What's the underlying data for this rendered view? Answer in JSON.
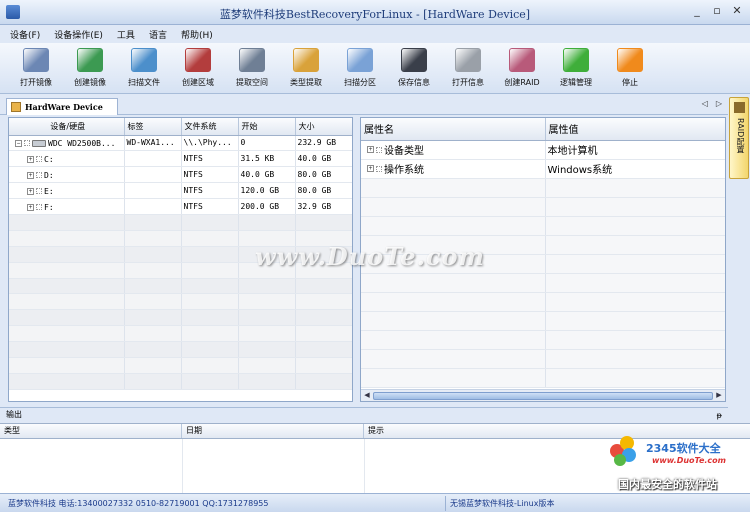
{
  "window": {
    "title": "蓝梦软件科技BestRecoveryForLinux - [HardWare Device]",
    "min": "_",
    "restore": "▫",
    "close": "✕"
  },
  "menu": [
    "设备(F)",
    "设备操作(E)",
    "工具",
    "语言",
    "帮助(H)"
  ],
  "toolbar": [
    {
      "label": "打开镜像",
      "icon": "open-image-icon",
      "color": "#6c87b4"
    },
    {
      "label": "创建镜像",
      "icon": "create-image-icon",
      "color": "#3c9a52"
    },
    {
      "label": "扫描文件",
      "icon": "scan-file-icon",
      "color": "#4c8fcb"
    },
    {
      "label": "创建区域",
      "icon": "create-region-icon",
      "color": "#b33d3d"
    },
    {
      "label": "提取空间",
      "icon": "extract-space-icon",
      "color": "#6f7f95"
    },
    {
      "label": "类型提取",
      "icon": "type-extract-icon",
      "color": "#d9a23a"
    },
    {
      "label": "扫描分区",
      "icon": "scan-partition-icon",
      "color": "#7aa2d6"
    },
    {
      "label": "保存信息",
      "icon": "save-info-icon",
      "color": "#3a3f4a"
    },
    {
      "label": "打开信息",
      "icon": "open-info-icon",
      "color": "#9aa0a8"
    },
    {
      "label": "创建RAID",
      "icon": "create-raid-icon",
      "color": "#b85a7a"
    },
    {
      "label": "逻辑管理",
      "icon": "logic-manage-icon",
      "color": "#3fae3a"
    },
    {
      "label": "停止",
      "icon": "stop-icon",
      "color": "#f08a1c"
    }
  ],
  "doc_tab": {
    "label": "HardWare Device",
    "nav_prev": "◁",
    "nav_next": "▷"
  },
  "side_tab": {
    "label": "RAID配置"
  },
  "device_table": {
    "headers": [
      "设备/硬盘",
      "标签",
      "文件系统",
      "开始",
      "大小"
    ],
    "rows": [
      {
        "name": "WDC WD2500B...",
        "label": "WD-WXA1...",
        "fs": "\\\\.\\Phy...",
        "start": "0",
        "size": "232.9 GB",
        "level": 0
      },
      {
        "name": "C:",
        "label": "",
        "fs": "NTFS",
        "start": "31.5 KB",
        "size": "40.0 GB",
        "level": 1
      },
      {
        "name": "D:",
        "label": "",
        "fs": "NTFS",
        "start": "40.0 GB",
        "size": "80.0 GB",
        "level": 1
      },
      {
        "name": "E:",
        "label": "",
        "fs": "NTFS",
        "start": "120.0 GB",
        "size": "80.0 GB",
        "level": 1
      },
      {
        "name": "F:",
        "label": "",
        "fs": "NTFS",
        "start": "200.0 GB",
        "size": "32.9 GB",
        "level": 1
      }
    ]
  },
  "property_table": {
    "headers": [
      "属性名",
      "属性值"
    ],
    "rows": [
      {
        "name": "设备类型",
        "value": "本地计算机"
      },
      {
        "name": "操作系统",
        "value": "Windows系统"
      }
    ]
  },
  "watermark": "www.DuoTe.com",
  "output": {
    "title": "输出",
    "pin": "ᵽ",
    "headers": [
      "类型",
      "日期",
      "提示"
    ]
  },
  "status": {
    "left": "蓝梦软件科技 电话:13400027332  0510-82719001  QQ:1731278955",
    "right": "无锡蓝梦软件科技-Linux版本"
  },
  "logo": {
    "brand": "2345软件大全",
    "url": "www.DuoTe.com",
    "slogan": "国内最安全的软件站"
  }
}
